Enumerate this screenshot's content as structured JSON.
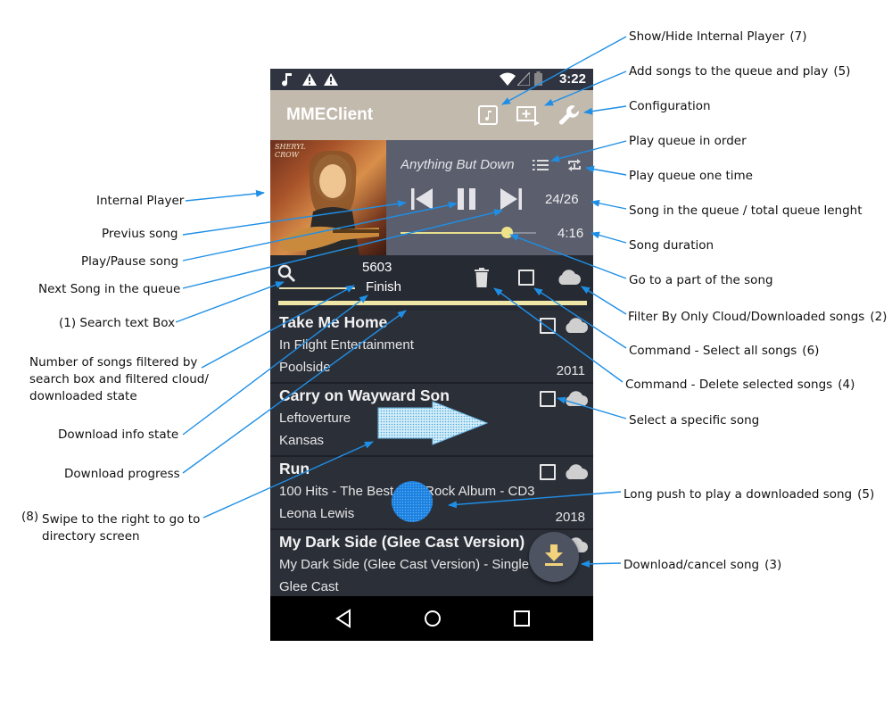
{
  "status_bar": {
    "time": "3:22",
    "icons": [
      "music-note-icon",
      "warning-icon",
      "warning-icon",
      "wifi-icon",
      "signal-icon",
      "battery-icon"
    ]
  },
  "app_bar": {
    "title": "MMEClient",
    "buttons": [
      "show-hide-player-icon",
      "add-to-queue-play-icon",
      "wrench-icon"
    ]
  },
  "player": {
    "album_art_text": "SHERYL CROW",
    "song_title": "Anything But Down",
    "queue_position": "24/26",
    "duration": "4:16",
    "seek_fraction": 0.78,
    "icons": [
      "previous-icon",
      "pause-icon",
      "next-icon",
      "queue-order-icon",
      "repeat-once-icon"
    ]
  },
  "filter_bar": {
    "song_count": "5603",
    "download_state": "Finish",
    "download_progress_fraction": 1.0,
    "icons": [
      "search-icon",
      "trash-icon",
      "checkbox-icon",
      "cloud-icon"
    ]
  },
  "songs": [
    {
      "title": "Take Me Home",
      "album": "In Flight Entertainment",
      "artist": "Poolside",
      "year": "2011"
    },
    {
      "title": "Carry on Wayward Son",
      "album": "Leftoverture",
      "artist": "Kansas",
      "year": ""
    },
    {
      "title": "Run",
      "album": "100 Hits - The Best Soft Rock Album - CD3",
      "artist": "Leona Lewis",
      "year": "2018"
    },
    {
      "title": "My Dark Side (Glee Cast Version)",
      "album": "My Dark Side (Glee Cast Version) - Single",
      "artist": "Glee Cast",
      "year": ""
    }
  ],
  "annotations": {
    "right": [
      {
        "text": "Show/Hide Internal Player",
        "num": "(7)"
      },
      {
        "text": "Add songs to the queue and play",
        "num": "(5)"
      },
      {
        "text": "Configuration",
        "num": ""
      },
      {
        "text": "Play queue in order",
        "num": ""
      },
      {
        "text": "Play queue one time",
        "num": ""
      },
      {
        "text": "Song in the queue / total queue lenght",
        "num": ""
      },
      {
        "text": "Song duration",
        "num": ""
      },
      {
        "text": "Go to a part of the song",
        "num": ""
      },
      {
        "text": "Filter By Only Cloud/Downloaded songs",
        "num": "(2)"
      },
      {
        "text": "Command - Select all songs",
        "num": "(6)"
      },
      {
        "text": "Command - Delete selected songs",
        "num": "(4)"
      },
      {
        "text": "Select a specific song",
        "num": ""
      },
      {
        "text": "Long push to play a downloaded song",
        "num": "(5)"
      },
      {
        "text": "Download/cancel song",
        "num": "(3)"
      }
    ],
    "left": [
      {
        "text": "Internal Player"
      },
      {
        "text": "Previus song"
      },
      {
        "text": "Play/Pause song"
      },
      {
        "text": "Next Song in the queue"
      },
      {
        "text": "(1) Search text Box"
      },
      {
        "text": "Number of songs filtered by search box and filtered cloud/ downloaded state"
      },
      {
        "text": "Download info state"
      },
      {
        "text": "Download progress"
      },
      {
        "text": "Swipe to the right to go to directory screen",
        "num": "(8)"
      }
    ]
  },
  "colors": {
    "annotation_arrow": "#1f8fe6",
    "app_bar": "#c3baae",
    "player_bg": "#5a5e6d",
    "list_bg": "#2b2f38",
    "accent_yellow": "#efe38a",
    "touch_marker": "#2b8fe8"
  }
}
